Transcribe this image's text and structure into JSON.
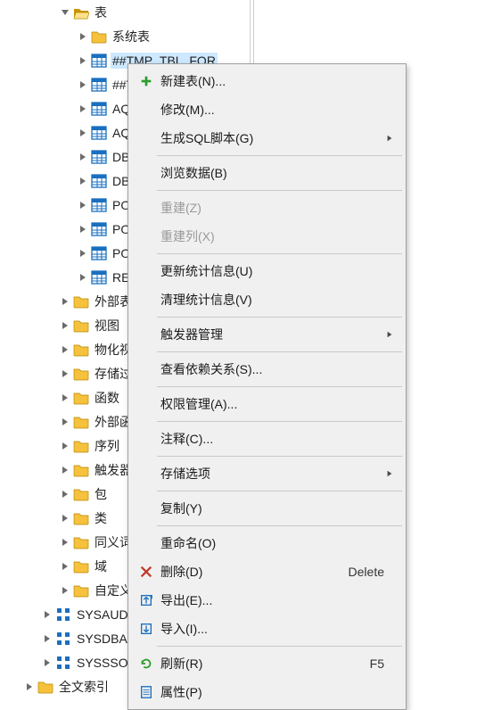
{
  "tree": [
    {
      "indent": 0,
      "caret": "down",
      "icon": "folder-open",
      "label": "表",
      "sel": false
    },
    {
      "indent": 1,
      "caret": "right",
      "icon": "folder",
      "label": "系统表",
      "sel": false
    },
    {
      "indent": 1,
      "caret": "right",
      "icon": "table",
      "label": "##TMP_TBL_FOR",
      "sel": true
    },
    {
      "indent": 1,
      "caret": "right",
      "icon": "table",
      "label": "##TMP",
      "sel": false
    },
    {
      "indent": 1,
      "caret": "right",
      "icon": "table",
      "label": "AQ$_Q",
      "sel": false
    },
    {
      "indent": 1,
      "caret": "right",
      "icon": "table",
      "label": "AQ$_Q",
      "sel": false
    },
    {
      "indent": 1,
      "caret": "right",
      "icon": "table",
      "label": "DBMS_",
      "sel": false
    },
    {
      "indent": 1,
      "caret": "right",
      "icon": "table",
      "label": "DBMS_",
      "sel": false
    },
    {
      "indent": 1,
      "caret": "right",
      "icon": "table",
      "label": "POLICIE",
      "sel": false
    },
    {
      "indent": 1,
      "caret": "right",
      "icon": "table",
      "label": "POLICY",
      "sel": false
    },
    {
      "indent": 1,
      "caret": "right",
      "icon": "table",
      "label": "POLICY",
      "sel": false
    },
    {
      "indent": 1,
      "caret": "right",
      "icon": "table",
      "label": "REG$",
      "sel": false
    },
    {
      "indent": 0,
      "caret": "right",
      "icon": "folder",
      "label": "外部表",
      "sel": false
    },
    {
      "indent": 0,
      "caret": "right",
      "icon": "folder",
      "label": "视图",
      "sel": false
    },
    {
      "indent": 0,
      "caret": "right",
      "icon": "folder",
      "label": "物化视图",
      "sel": false
    },
    {
      "indent": 0,
      "caret": "right",
      "icon": "folder",
      "label": "存储过程",
      "sel": false
    },
    {
      "indent": 0,
      "caret": "right",
      "icon": "folder",
      "label": "函数",
      "sel": false
    },
    {
      "indent": 0,
      "caret": "right",
      "icon": "folder",
      "label": "外部函数",
      "sel": false
    },
    {
      "indent": 0,
      "caret": "right",
      "icon": "folder",
      "label": "序列",
      "sel": false
    },
    {
      "indent": 0,
      "caret": "right",
      "icon": "folder",
      "label": "触发器",
      "sel": false
    },
    {
      "indent": 0,
      "caret": "right",
      "icon": "folder",
      "label": "包",
      "sel": false
    },
    {
      "indent": 0,
      "caret": "right",
      "icon": "folder",
      "label": "类",
      "sel": false
    },
    {
      "indent": 0,
      "caret": "right",
      "icon": "folder",
      "label": "同义词",
      "sel": false
    },
    {
      "indent": 0,
      "caret": "right",
      "icon": "folder",
      "label": "域",
      "sel": false
    },
    {
      "indent": 0,
      "caret": "right",
      "icon": "folder",
      "label": "自定义类型",
      "sel": false
    },
    {
      "indent": -1,
      "caret": "right",
      "icon": "schema",
      "label": "SYSAUDITO",
      "sel": false
    },
    {
      "indent": -1,
      "caret": "right",
      "icon": "schema",
      "label": "SYSDBA",
      "sel": false
    },
    {
      "indent": -1,
      "caret": "right",
      "icon": "schema",
      "label": "SYSSSO",
      "sel": false
    },
    {
      "indent": -2,
      "caret": "right",
      "icon": "folder",
      "label": "全文索引",
      "sel": false
    }
  ],
  "ctx": [
    {
      "type": "item",
      "icon": "plus",
      "label": "新建表(N)...",
      "shortcut": "",
      "sub": false,
      "enabled": true
    },
    {
      "type": "item",
      "icon": "",
      "label": "修改(M)...",
      "shortcut": "",
      "sub": false,
      "enabled": true
    },
    {
      "type": "item",
      "icon": "",
      "label": "生成SQL脚本(G)",
      "shortcut": "",
      "sub": true,
      "enabled": true
    },
    {
      "type": "sep"
    },
    {
      "type": "item",
      "icon": "",
      "label": "浏览数据(B)",
      "shortcut": "",
      "sub": false,
      "enabled": true
    },
    {
      "type": "sep"
    },
    {
      "type": "item",
      "icon": "",
      "label": "重建(Z)",
      "shortcut": "",
      "sub": false,
      "enabled": false
    },
    {
      "type": "item",
      "icon": "",
      "label": "重建列(X)",
      "shortcut": "",
      "sub": false,
      "enabled": false
    },
    {
      "type": "sep"
    },
    {
      "type": "item",
      "icon": "",
      "label": "更新统计信息(U)",
      "shortcut": "",
      "sub": false,
      "enabled": true
    },
    {
      "type": "item",
      "icon": "",
      "label": "清理统计信息(V)",
      "shortcut": "",
      "sub": false,
      "enabled": true
    },
    {
      "type": "sep"
    },
    {
      "type": "item",
      "icon": "",
      "label": "触发器管理",
      "shortcut": "",
      "sub": true,
      "enabled": true
    },
    {
      "type": "sep"
    },
    {
      "type": "item",
      "icon": "",
      "label": "查看依赖关系(S)...",
      "shortcut": "",
      "sub": false,
      "enabled": true
    },
    {
      "type": "sep"
    },
    {
      "type": "item",
      "icon": "",
      "label": "权限管理(A)...",
      "shortcut": "",
      "sub": false,
      "enabled": true
    },
    {
      "type": "sep"
    },
    {
      "type": "item",
      "icon": "",
      "label": "注释(C)...",
      "shortcut": "",
      "sub": false,
      "enabled": true
    },
    {
      "type": "sep"
    },
    {
      "type": "item",
      "icon": "",
      "label": "存储选项",
      "shortcut": "",
      "sub": true,
      "enabled": true
    },
    {
      "type": "sep"
    },
    {
      "type": "item",
      "icon": "",
      "label": "复制(Y)",
      "shortcut": "",
      "sub": false,
      "enabled": true
    },
    {
      "type": "sep"
    },
    {
      "type": "item",
      "icon": "",
      "label": "重命名(O)",
      "shortcut": "",
      "sub": false,
      "enabled": true
    },
    {
      "type": "item",
      "icon": "delete",
      "label": "删除(D)",
      "shortcut": "Delete",
      "sub": false,
      "enabled": true
    },
    {
      "type": "item",
      "icon": "export",
      "label": "导出(E)...",
      "shortcut": "",
      "sub": false,
      "enabled": true
    },
    {
      "type": "item",
      "icon": "import",
      "label": "导入(I)...",
      "shortcut": "",
      "sub": false,
      "enabled": true
    },
    {
      "type": "sep"
    },
    {
      "type": "item",
      "icon": "refresh",
      "label": "刷新(R)",
      "shortcut": "F5",
      "sub": false,
      "enabled": true
    },
    {
      "type": "item",
      "icon": "props",
      "label": "属性(P)",
      "shortcut": "",
      "sub": false,
      "enabled": true
    }
  ]
}
